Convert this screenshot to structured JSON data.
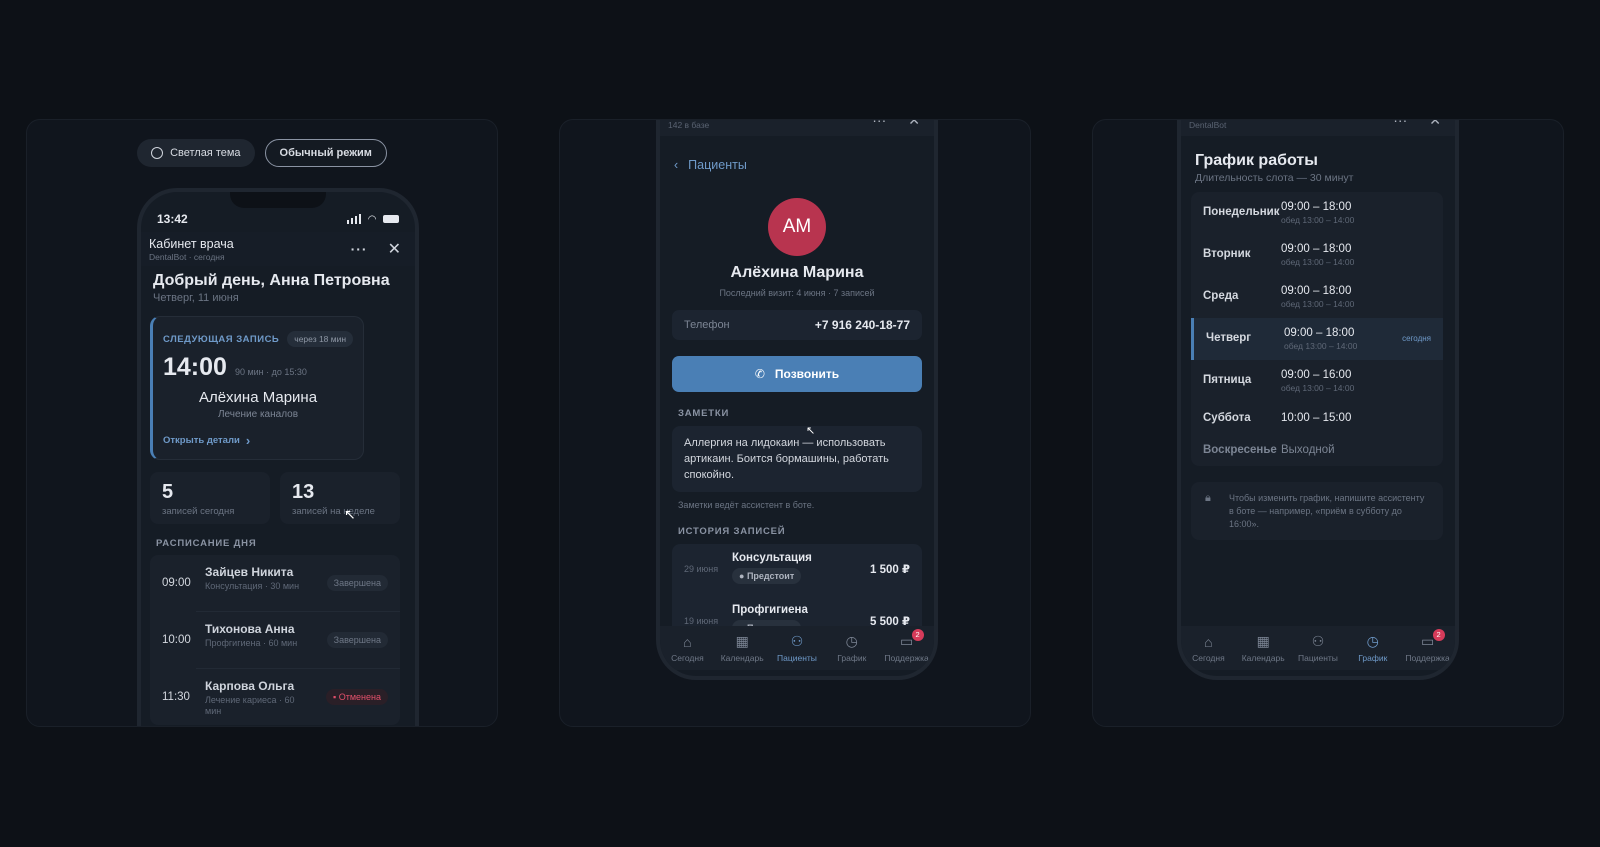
{
  "left": {
    "theme_button": "Светлая тема",
    "mode_button": "Обычный режим",
    "status_time": "13:42",
    "app_title": "Кабинет врача",
    "app_subtitle": "DentalBot · сегодня",
    "greeting": "Добрый день, Анна Петровна",
    "date": "Четверг, 11 июня",
    "next": {
      "label": "СЛЕДУЮЩАЯ ЗАПИСЬ",
      "in": "через 18 мин",
      "time": "14:00",
      "duration": "90 мин · до 15:30",
      "patient": "Алёхина Марина",
      "service": "Лечение каналов",
      "link": "Открыть детали"
    },
    "stats": [
      {
        "value": "5",
        "label": "записей сегодня"
      },
      {
        "value": "13",
        "label": "записей на неделе"
      }
    ],
    "schedule_title": "РАСПИСАНИЕ ДНЯ",
    "schedule": [
      {
        "time": "09:00",
        "name": "Зайцев Никита",
        "desc": "Консультация · 30 мин",
        "status": "Завершена"
      },
      {
        "time": "10:00",
        "name": "Тихонова Анна",
        "desc": "Профгигиена · 60 мин",
        "status": "Завершена"
      },
      {
        "time": "11:30",
        "name": "Карпова Ольга",
        "desc": "Лечение кариеса · 60 мин",
        "status": "Отменена"
      }
    ]
  },
  "middle": {
    "header_sub": "142 в базе",
    "back": "Пациенты",
    "initials": "АМ",
    "name": "Алёхина Марина",
    "last_visit": "Последний визит: 4 июня · 7 записей",
    "phone_label": "Телефон",
    "phone_value": "+7 916 240-18-77",
    "call": "Позвонить",
    "notes_title": "ЗАМЕТКИ",
    "notes": "Аллергия на лидокаин — использовать артикаин. Боится бормашины, работать спокойно.",
    "notes_hint": "Заметки ведёт ассистент в боте.",
    "history_title": "ИСТОРИЯ ЗАПИСЕЙ",
    "history": [
      {
        "date": "29 июня",
        "title": "Консультация",
        "status": "Предстоит",
        "price": "1 500 ₽"
      },
      {
        "date": "19 июня",
        "title": "Профгигиена",
        "status": "Предстоит",
        "price": "5 500 ₽"
      }
    ]
  },
  "right": {
    "header_sub": "DentalBot",
    "title": "График работы",
    "subtitle": "Длительность слота — 30 минут",
    "days": [
      {
        "name": "Понедельник",
        "hours": "09:00 – 18:00",
        "lunch": "обед 13:00 – 14:00"
      },
      {
        "name": "Вторник",
        "hours": "09:00 – 18:00",
        "lunch": "обед 13:00 – 14:00"
      },
      {
        "name": "Среда",
        "hours": "09:00 – 18:00",
        "lunch": "обед 13:00 – 14:00"
      },
      {
        "name": "Четверг",
        "hours": "09:00 – 18:00",
        "lunch": "обед 13:00 – 14:00",
        "today": "сегодня"
      },
      {
        "name": "Пятница",
        "hours": "09:00 – 16:00",
        "lunch": "обед 13:00 – 14:00"
      },
      {
        "name": "Суббота",
        "hours": "10:00 – 15:00",
        "lunch": ""
      },
      {
        "name": "Воскресенье",
        "hours": "Выходной",
        "lunch": ""
      }
    ],
    "note": "Чтобы изменить график, напишите ассистенту в боте — например, «приём в субботу до 16:00»."
  },
  "tabs": [
    "Сегодня",
    "Календарь",
    "Пациенты",
    "График",
    "Поддержка"
  ],
  "support_badge": "2",
  "colors": {
    "accent": "#4a7fb5",
    "danger": "#e3506b",
    "avatar": "#b8344f"
  }
}
